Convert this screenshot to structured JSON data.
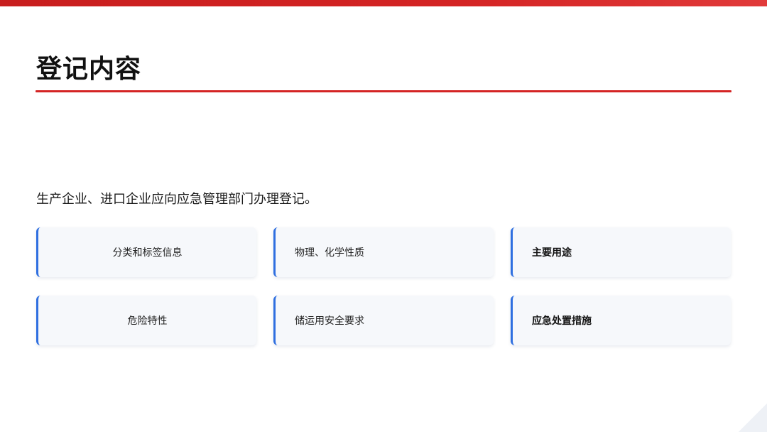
{
  "colors": {
    "accent_red": "#d42424",
    "card_border_blue": "#2f6fe0",
    "card_bg": "#f6f8fb"
  },
  "header": {
    "title": "登记内容"
  },
  "intro": {
    "text": "生产企业、进口企业应向应急管理部门办理登记。"
  },
  "cards": [
    {
      "label": "分类和标签信息"
    },
    {
      "label": "物理、化学性质"
    },
    {
      "label": "主要用途"
    },
    {
      "label": "危险特性"
    },
    {
      "label": "储运用安全要求"
    },
    {
      "label": "应急处置措施"
    }
  ]
}
